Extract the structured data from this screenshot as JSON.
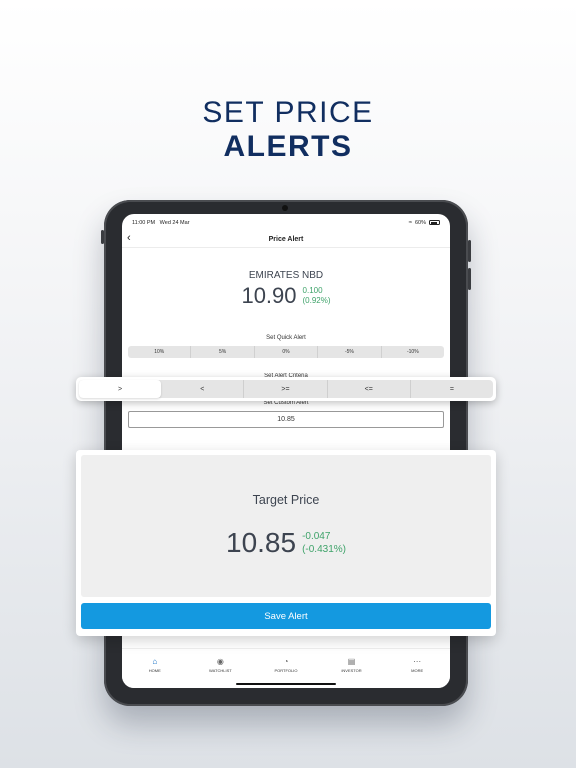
{
  "colors": {
    "headline": "#112e60",
    "positive": "#3fa36a",
    "button": "#1499e0"
  },
  "headline": {
    "line1": "SET PRICE",
    "line2": "ALERTS"
  },
  "status": {
    "time": "11:00 PM",
    "date": "Wed 24 Mar",
    "battery": "60%"
  },
  "nav": {
    "title": "Price Alert",
    "back_icon": "chevron-left-icon"
  },
  "stock": {
    "name": "EMIRATES NBD",
    "price": "10.90",
    "change": "0.100",
    "change_pct": "(0.92%)"
  },
  "quick_alert": {
    "label": "Set Quick Alert",
    "options": [
      "10%",
      "5%",
      "0%",
      "-5%",
      "-10%"
    ]
  },
  "criteria": {
    "label": "Set Alert Criteria",
    "options": [
      ">",
      "<",
      ">=",
      "<=",
      "="
    ],
    "selected": ">"
  },
  "custom_alert": {
    "label": "Set Custom Alert",
    "value": "10.85"
  },
  "target": {
    "title": "Target Price",
    "price": "10.85",
    "change": "-0.047",
    "change_pct": "(-0.431%)"
  },
  "save_label": "Save Alert",
  "tabs": [
    {
      "label": "HOME",
      "icon": "home-icon"
    },
    {
      "label": "WATCHLIST",
      "icon": "eye-icon"
    },
    {
      "label": "PORTFOLIO",
      "icon": "pie-chart-icon"
    },
    {
      "label": "iNVESTOR",
      "icon": "card-icon"
    },
    {
      "label": "MORE",
      "icon": "more-icon"
    }
  ]
}
